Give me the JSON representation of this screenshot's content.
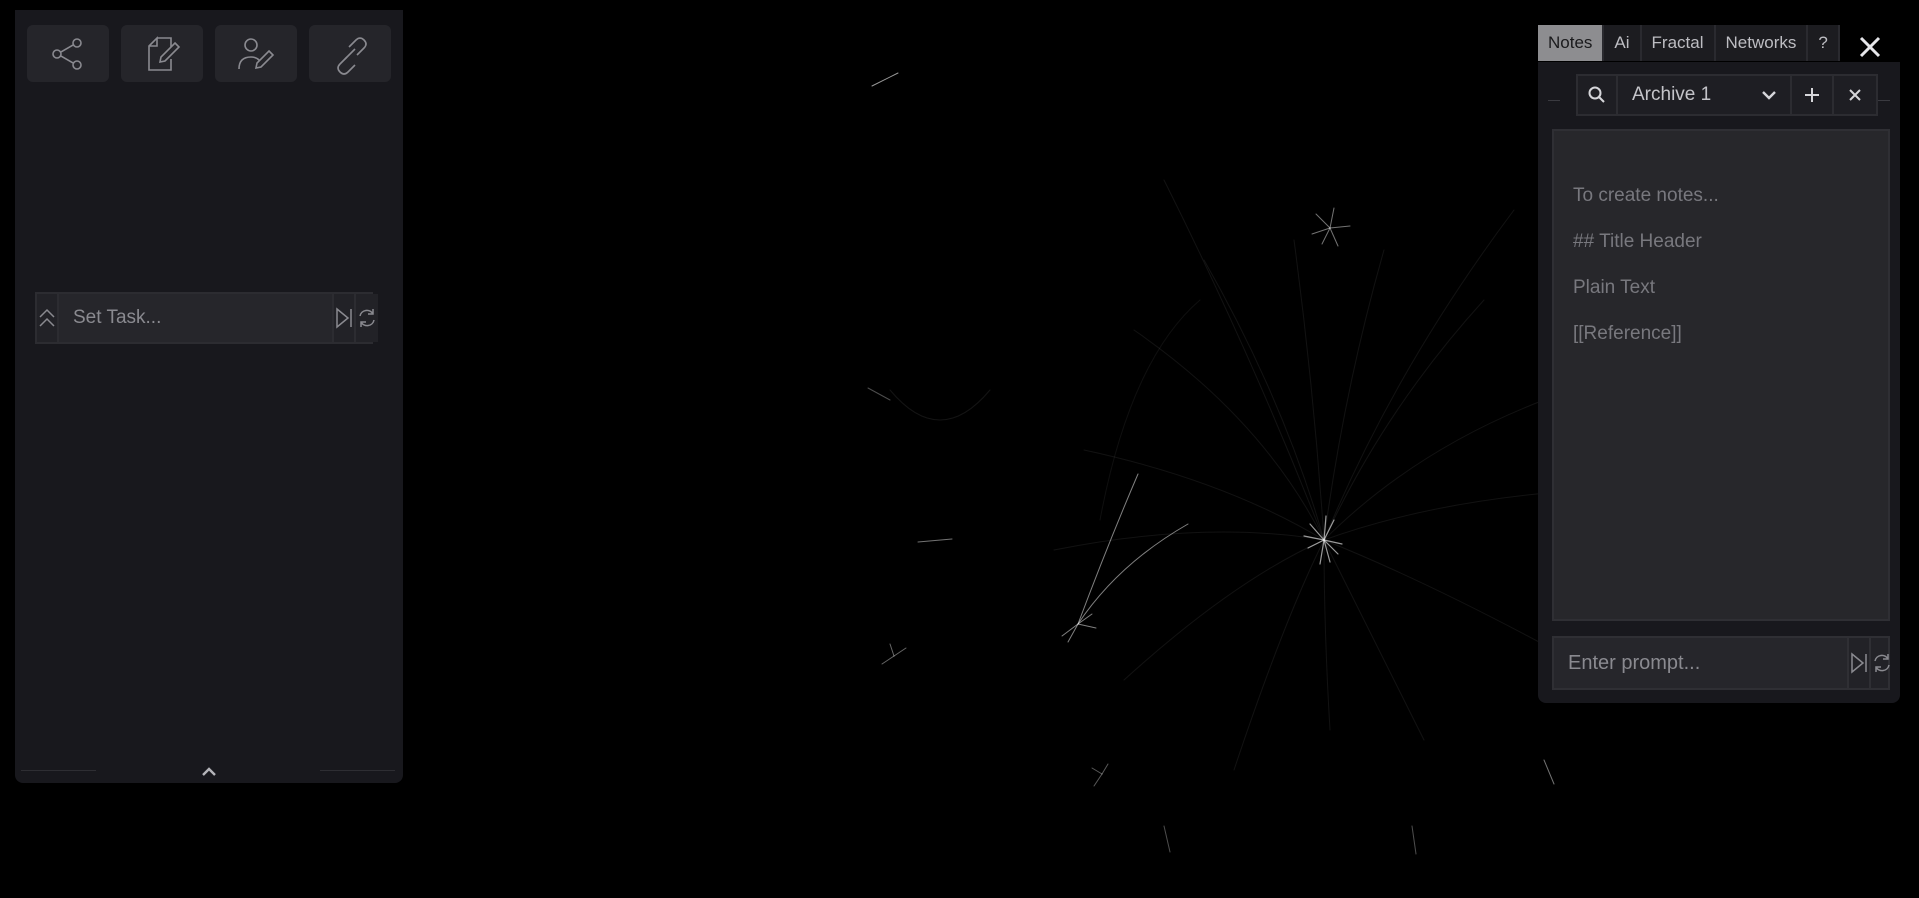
{
  "left_panel": {
    "tools": [
      {
        "icon": "share-icon"
      },
      {
        "icon": "edit-document-icon"
      },
      {
        "icon": "user-edit-icon"
      },
      {
        "icon": "link-icon"
      }
    ],
    "task": {
      "placeholder": "Set Task...",
      "icons": [
        "collapse-up-icon",
        "skip-next-icon",
        "refresh-icon"
      ]
    },
    "bottom_toggle_icon": "chevron-up-icon"
  },
  "notes_panel": {
    "tabs": [
      {
        "label": "Notes",
        "active": true
      },
      {
        "label": "Ai",
        "active": false
      },
      {
        "label": "Fractal",
        "active": false
      },
      {
        "label": "Networks",
        "active": false
      },
      {
        "label": "?",
        "active": false
      }
    ],
    "close_icon": "close-icon",
    "archive": {
      "selected": "Archive 1",
      "icons": [
        "search-icon",
        "chevron-down-icon",
        "plus-icon",
        "close-icon"
      ]
    },
    "note_placeholder_lines": [
      "To create notes...",
      "## Title Header",
      "Plain Text",
      "[[Reference]]"
    ],
    "prompt": {
      "placeholder": "Enter prompt...",
      "icons": [
        "skip-next-icon",
        "refresh-icon"
      ]
    }
  },
  "colors": {
    "background": "#000000",
    "panel": "#18181d",
    "active_tab": "#8d8d90"
  }
}
